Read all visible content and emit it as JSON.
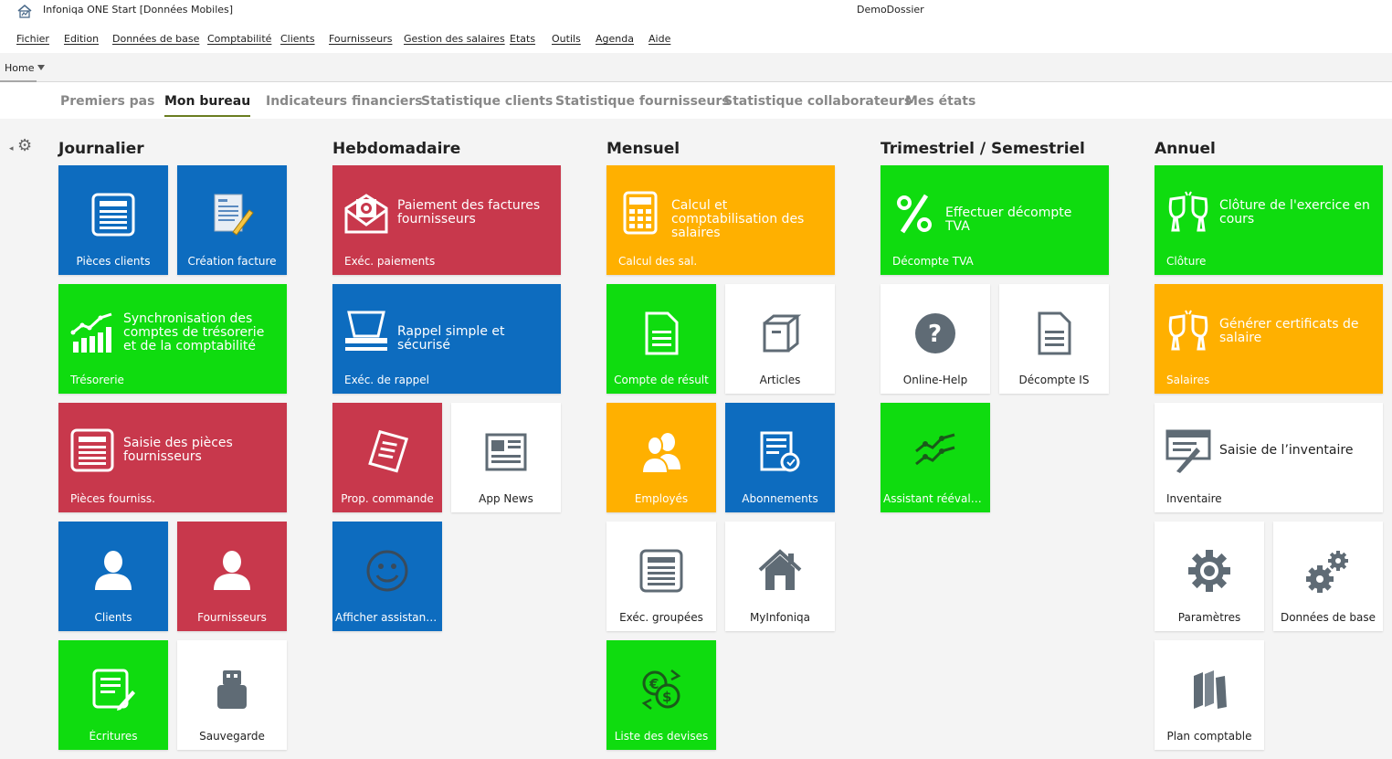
{
  "window": {
    "title": "Infoniqa ONE Start [Données Mobiles]",
    "dossier": "DemoDossier"
  },
  "menu": [
    "Fichier",
    "Edition",
    "Données de base",
    "Comptabilité",
    "Clients",
    "Fournisseurs",
    "Gestion des salaires",
    "Etats",
    "Outils",
    "Agenda",
    "Aide"
  ],
  "home_tab": "Home",
  "tabs": [
    "Premiers pas",
    "Mon bureau",
    "Indicateurs financiers",
    "Statistique clients",
    "Statistique fournisseurs",
    "Statistique collaborateurs",
    "Mes états"
  ],
  "active_tab": "Mon bureau",
  "columns": [
    "Journalier",
    "Hebdomadaire",
    "Mensuel",
    "Trimestriel / Semestriel",
    "Annuel"
  ],
  "colors": {
    "blue": "#0d6cbf",
    "red": "#c8384c",
    "green": "#0fdc0f",
    "orange": "#ffb000",
    "white": "#ffffff",
    "tab_underline": "#6a7d20"
  },
  "tiles": {
    "pieces_clients": {
      "label": "Pièces clients",
      "icon": "document-list-icon"
    },
    "creation_facture": {
      "label": "Création facture",
      "icon": "invoice-edit-icon"
    },
    "tresorerie": {
      "label": "Trésorerie",
      "title": "Synchronisation des comptes de trésorerie et de la comptabilité",
      "icon": "bar-chart-icon"
    },
    "pieces_fourniss": {
      "label": "Pièces fourniss.",
      "title": "Saisie des pièces fournisseurs",
      "icon": "document-list-icon"
    },
    "clients": {
      "label": "Clients",
      "icon": "user-icon"
    },
    "fournisseurs": {
      "label": "Fournisseurs",
      "icon": "user-icon"
    },
    "ecritures": {
      "label": "Écritures",
      "icon": "document-edit-icon"
    },
    "sauvegarde": {
      "label": "Sauvegarde",
      "icon": "usb-drive-icon"
    },
    "paiements": {
      "label": "Exéc. paiements",
      "title": "Paiement des factures fournisseurs",
      "icon": "mail-money-icon"
    },
    "rappel": {
      "label": "Exéc. de rappel",
      "title": "Rappel simple et sécurisé",
      "icon": "printer-icon"
    },
    "prop_commande": {
      "label": "Prop. commande",
      "icon": "receipt-icon"
    },
    "app_news": {
      "label": "App News",
      "icon": "newspaper-icon"
    },
    "assistant": {
      "label": "Afficher assistant do...",
      "icon": "smiley-icon"
    },
    "calcul_sal": {
      "label": "Calcul des sal.",
      "title": "Calcul et comptabilisation des salaires",
      "icon": "calculator-icon"
    },
    "compte_result": {
      "label": "Compte de résult",
      "icon": "document-icon"
    },
    "articles": {
      "label": "Articles",
      "icon": "box-icon"
    },
    "employes": {
      "label": "Employés",
      "icon": "users-icon"
    },
    "abonnements": {
      "label": "Abonnements",
      "icon": "subscription-icon"
    },
    "exec_groupees": {
      "label": "Exéc. groupées",
      "icon": "document-list-icon"
    },
    "myinfoniqa": {
      "label": "MyInfoniqa",
      "icon": "home-icon"
    },
    "devises": {
      "label": "Liste des devises",
      "icon": "currency-exchange-icon"
    },
    "tva": {
      "label": "Décompte TVA",
      "title": "Effectuer décompte TVA",
      "icon": "percent-icon"
    },
    "online_help": {
      "label": "Online-Help",
      "icon": "help-icon"
    },
    "decompte_is": {
      "label": "Décompte IS",
      "icon": "document-icon"
    },
    "reevaluation": {
      "label": "Assistant réévalutati...",
      "icon": "trend-icon"
    },
    "cloture": {
      "label": "Clôture",
      "title": "Clôture de l'exercice en cours",
      "icon": "champagne-icon"
    },
    "salaires": {
      "label": "Salaires",
      "title": "Générer certificats de salaire",
      "icon": "champagne-icon"
    },
    "inventaire": {
      "label": "Inventaire",
      "title": "Saisie de l’inventaire",
      "icon": "inventory-icon"
    },
    "parametres": {
      "label": "Paramètres",
      "icon": "gear-icon"
    },
    "donnees_base": {
      "label": "Données de base",
      "icon": "gears-icon"
    },
    "plan_comptable": {
      "label": "Plan comptable",
      "icon": "books-icon"
    }
  }
}
